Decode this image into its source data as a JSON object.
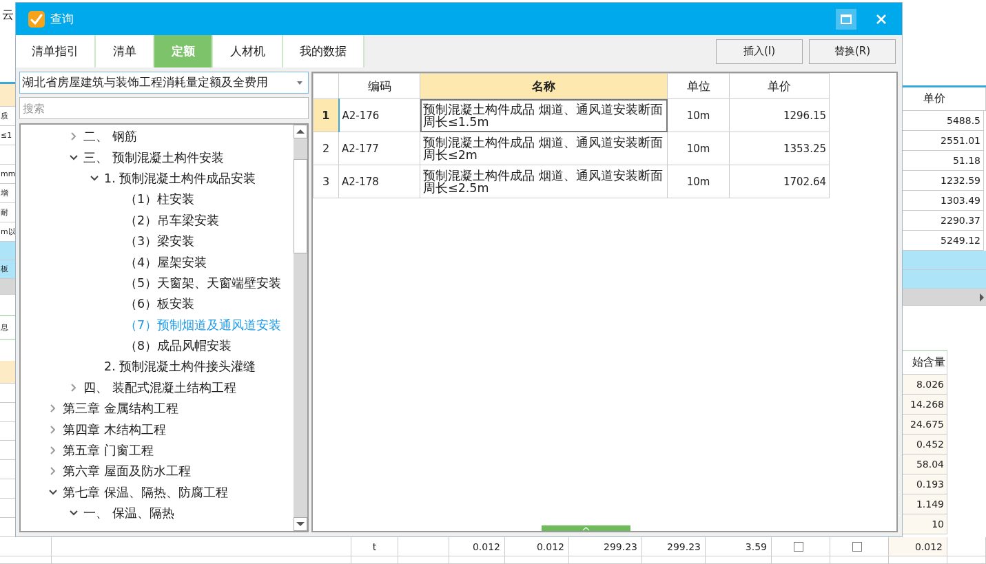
{
  "background": {
    "corner_text": "云",
    "left_rows": [
      {
        "kind": "header"
      },
      {
        "kind": "row",
        "text": "质"
      },
      {
        "kind": "row",
        "text": "≤1"
      },
      {
        "kind": "row"
      },
      {
        "kind": "row",
        "text": "mm"
      },
      {
        "kind": "row",
        "text": "增"
      },
      {
        "kind": "row",
        "text": "耐"
      },
      {
        "kind": "row",
        "text": "m以"
      },
      {
        "kind": "highlight"
      },
      {
        "kind": "highlight",
        "text": "板"
      },
      {
        "kind": "scrollbar"
      },
      {
        "kind": "gap"
      },
      {
        "kind": "info",
        "text": "息"
      },
      {
        "kind": "gap"
      },
      {
        "kind": "header"
      },
      {
        "kind": "row"
      },
      {
        "kind": "row"
      },
      {
        "kind": "row"
      },
      {
        "kind": "row"
      },
      {
        "kind": "row"
      },
      {
        "kind": "row"
      },
      {
        "kind": "row"
      },
      {
        "kind": "row"
      }
    ],
    "right_rows": [
      {
        "kind": "header",
        "text": "单价"
      },
      {
        "kind": "row",
        "text": "5488.5"
      },
      {
        "kind": "row",
        "text": "2551.01"
      },
      {
        "kind": "row",
        "text": "51.18"
      },
      {
        "kind": "row",
        "text": "1232.59"
      },
      {
        "kind": "row",
        "text": "1303.49"
      },
      {
        "kind": "row",
        "text": "2290.37"
      },
      {
        "kind": "row",
        "text": "5249.12"
      },
      {
        "kind": "highlight"
      },
      {
        "kind": "highlight"
      },
      {
        "kind": "scrollbar"
      },
      {
        "kind": "gap"
      },
      {
        "kind": "gap"
      },
      {
        "kind": "subheader",
        "text": "始含量"
      },
      {
        "kind": "subrow",
        "text": "8.026"
      },
      {
        "kind": "subrow",
        "text": "14.268"
      },
      {
        "kind": "subrow",
        "text": "24.675"
      },
      {
        "kind": "subrow",
        "text": "0.452"
      },
      {
        "kind": "subrow",
        "text": "58.04"
      },
      {
        "kind": "subrow",
        "text": "0.193"
      },
      {
        "kind": "subrow",
        "text": "1.149"
      },
      {
        "kind": "subrow",
        "text": "10"
      }
    ],
    "bottom_row": [
      {
        "kind": "empty"
      },
      {
        "kind": "empty"
      },
      {
        "kind": "text",
        "text": "t"
      },
      {
        "kind": "empty"
      },
      {
        "kind": "text",
        "text": "0.012"
      },
      {
        "kind": "text",
        "text": "0.012"
      },
      {
        "kind": "text",
        "text": "299.23"
      },
      {
        "kind": "text",
        "text": "299.23"
      },
      {
        "kind": "text",
        "text": "3.59"
      },
      {
        "kind": "checkbox",
        "checked": false
      },
      {
        "kind": "checkbox",
        "checked": false
      },
      {
        "kind": "text",
        "text": "0.012"
      },
      {
        "kind": "empty"
      }
    ]
  },
  "dialog": {
    "title": "查询",
    "tabs": [
      {
        "label": "清单指引",
        "selected": false
      },
      {
        "label": "清单",
        "selected": false
      },
      {
        "label": "定额",
        "selected": true
      },
      {
        "label": "人材机",
        "selected": false
      },
      {
        "label": "我的数据",
        "selected": false
      }
    ],
    "buttons": [
      "插入(I)",
      "替换(R)"
    ],
    "library": "湖北省房屋建筑与装饰工程消耗量定额及全费用",
    "search": {
      "placeholder": "搜索"
    },
    "tree": {
      "partial_items": [
        {
          "label": "二、 钢筋",
          "expanded": false,
          "selected": false
        },
        {
          "label": "三、 预制混凝土构件安装",
          "expanded": true,
          "selected": false,
          "children": [
            {
              "label": "1. 预制混凝土构件成品安装",
              "expanded": true,
              "selected": false,
              "children": [
                {
                  "label": "（1）柱安装",
                  "selected": false
                },
                {
                  "label": "（2）吊车梁安装",
                  "selected": false
                },
                {
                  "label": "（3）梁安装",
                  "selected": false
                },
                {
                  "label": "（4）屋架安装",
                  "selected": false
                },
                {
                  "label": "（5）天窗架、天窗端壁安装",
                  "selected": false
                },
                {
                  "label": "（6）板安装",
                  "selected": false
                },
                {
                  "label": "（7）预制烟道及通风道安装",
                  "selected": true
                },
                {
                  "label": "（8）成品风帽安装",
                  "selected": false
                }
              ]
            },
            {
              "label": "2. 预制混凝土构件接头灌缝",
              "selected": false
            }
          ]
        },
        {
          "label": "四、 装配式混凝土结构工程",
          "expanded": false,
          "selected": false
        }
      ],
      "items": [
        {
          "label": "第三章 金属结构工程",
          "expanded": false,
          "selected": false
        },
        {
          "label": "第四章 木结构工程",
          "expanded": false,
          "selected": false
        },
        {
          "label": "第五章 门窗工程",
          "expanded": false,
          "selected": false
        },
        {
          "label": "第六章 屋面及防水工程",
          "expanded": false,
          "selected": false
        },
        {
          "label": "第七章 保温、隔热、防腐工程",
          "expanded": true,
          "selected": false,
          "children": [
            {
              "label": "一、 保温、隔热",
              "expanded": true,
              "selected": false
            }
          ]
        }
      ]
    },
    "table": {
      "columns": [
        "编码",
        "名称",
        "单位",
        "单价"
      ],
      "rows": [
        {
          "num": "1",
          "code": "A2-176",
          "name": "预制混凝土构件成品 烟道、通风道安装断面周长≤1.5m",
          "unit": "10m",
          "price": "1296.15",
          "selected": true
        },
        {
          "num": "2",
          "code": "A2-177",
          "name": "预制混凝土构件成品 烟道、通风道安装断面周长≤2m",
          "unit": "10m",
          "price": "1353.25",
          "selected": false
        },
        {
          "num": "3",
          "code": "A2-178",
          "name": "预制混凝土构件成品 烟道、通风道安装断面周长≤2.5m",
          "unit": "10m",
          "price": "1702.64",
          "selected": false
        }
      ]
    }
  }
}
